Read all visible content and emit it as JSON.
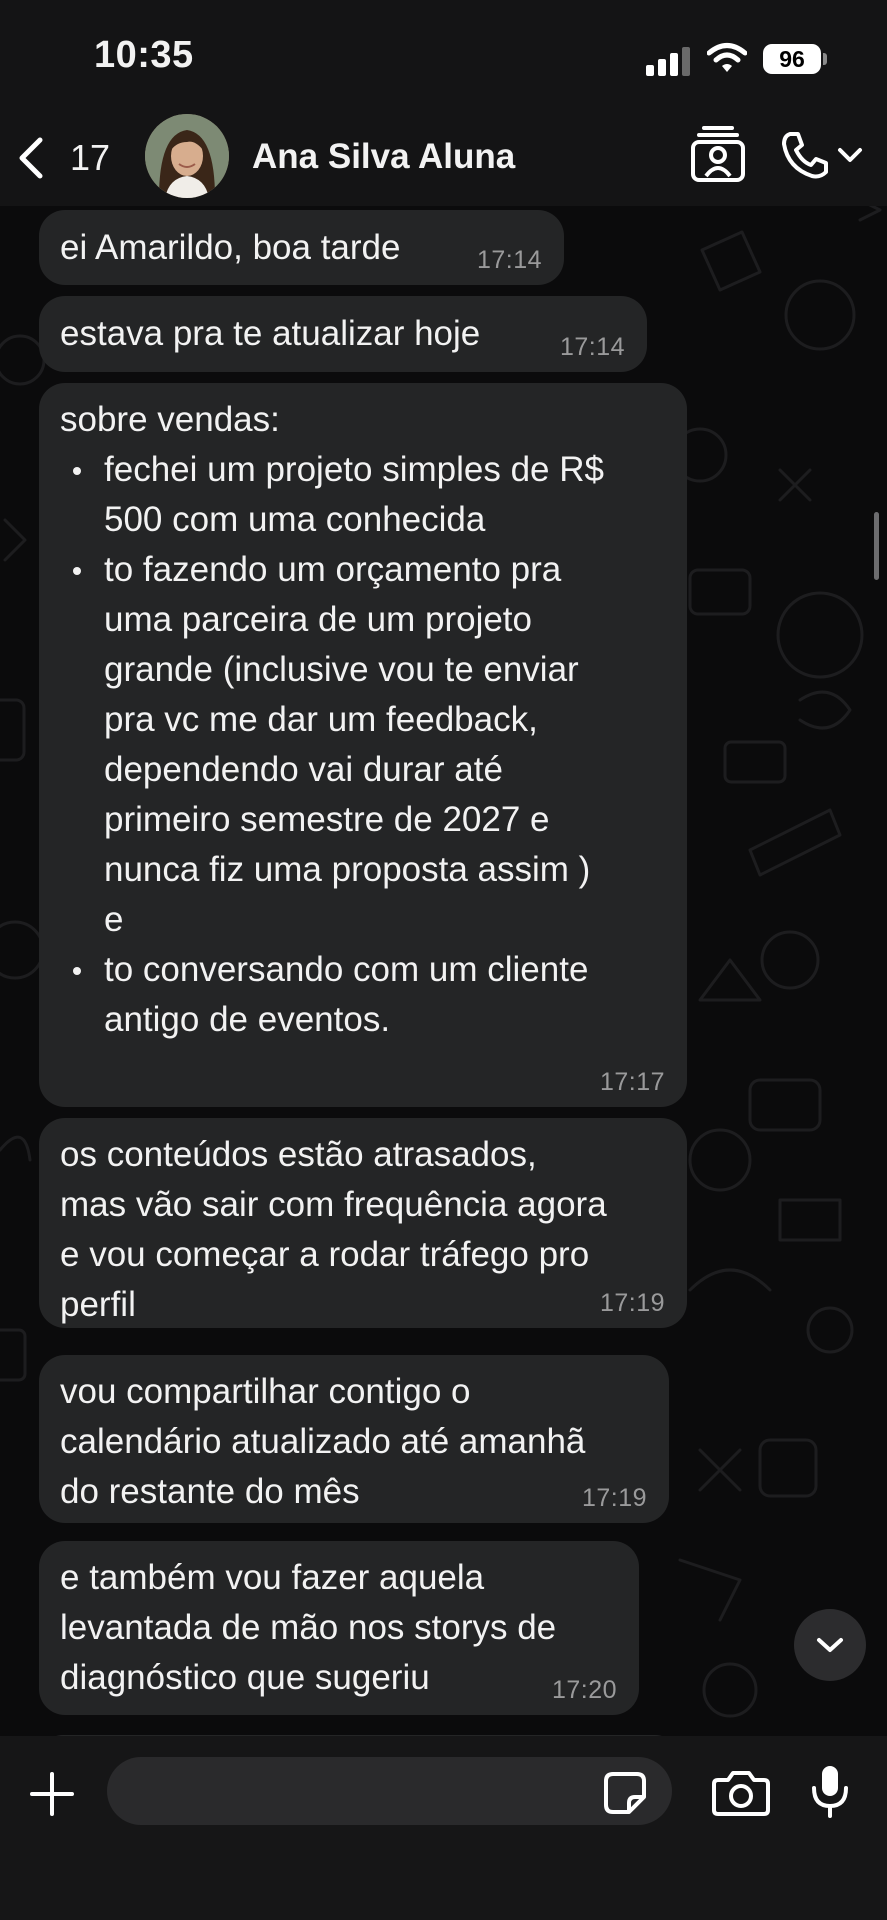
{
  "status_bar": {
    "time": "10:35",
    "battery": "96"
  },
  "header": {
    "back_count": "17",
    "contact_name": "Ana Silva Aluna"
  },
  "messages": [
    {
      "text": "ei Amarildo, boa tarde",
      "time": "17:14"
    },
    {
      "text": "estava pra te atualizar hoje",
      "time": "17:14"
    },
    {
      "text": "sobre vendas:",
      "bullets": [
        [
          "fechei um projeto simples de R$",
          "500 com uma conhecida"
        ],
        [
          "to fazendo um orçamento pra",
          "uma parceira de um projeto",
          "grande (inclusive vou te enviar",
          "pra vc me dar um feedback,",
          "dependendo vai durar até",
          "primeiro semestre de 2027 e",
          "nunca fiz uma proposta assim )",
          "e"
        ],
        [
          "to conversando com um cliente",
          "antigo de eventos."
        ]
      ],
      "time": "17:17"
    },
    {
      "lines": [
        "os conteúdos estão atrasados,",
        "mas vão sair com frequência agora",
        "e vou começar a rodar tráfego pro",
        "perfil"
      ],
      "time": "17:19"
    },
    {
      "lines": [
        "vou compartilhar contigo o",
        "calendário atualizado até amanhã",
        "do restante do mês"
      ],
      "time": "17:19"
    },
    {
      "lines": [
        "e também vou fazer aquela",
        "levantada de mão nos storys de",
        "diagnóstico que sugeriu"
      ],
      "time": "17:20"
    }
  ],
  "composer": {
    "placeholder": ""
  },
  "icons": {
    "back": "chevron-left-icon",
    "contact_card": "contact-card-icon",
    "call": "phone-icon",
    "call_menu": "chevron-down-icon",
    "attach": "plus-icon",
    "sticker": "sticker-icon",
    "camera": "camera-icon",
    "mic": "microphone-icon",
    "scroll_down": "chevron-down-icon"
  },
  "colors": {
    "background": "#0b0b0c",
    "bubble": "#242526",
    "header": "#141415",
    "text": "#f2f2f2",
    "timestamp": "#9a9a9b"
  }
}
